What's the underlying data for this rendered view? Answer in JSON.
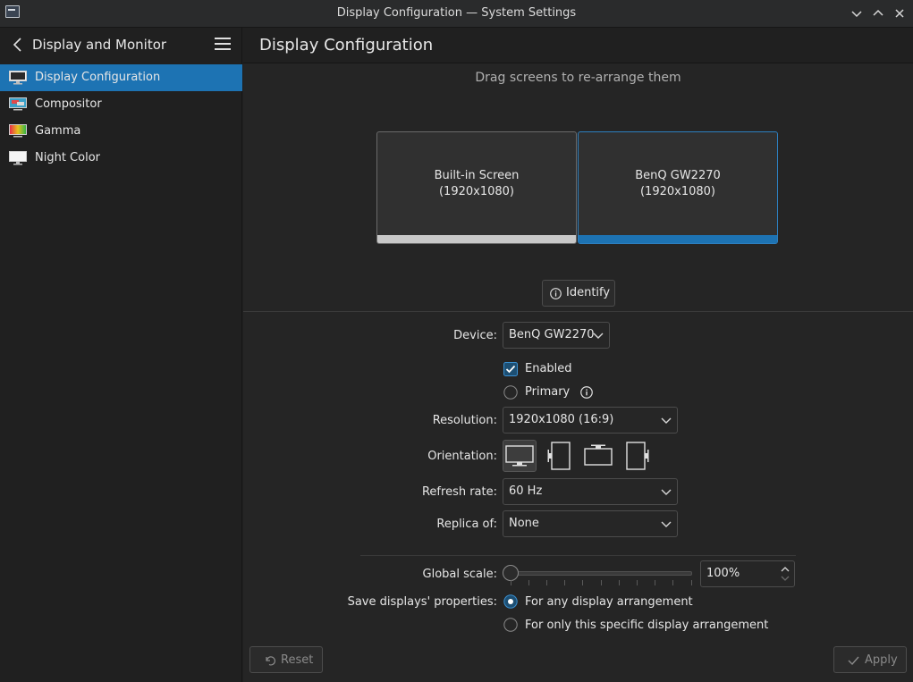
{
  "window": {
    "title": "Display Configuration — System Settings"
  },
  "sidebar": {
    "header_title": "Display and Monitor",
    "items": [
      {
        "label": "Display Configuration",
        "icon": "monitor-icon",
        "active": true
      },
      {
        "label": "Compositor",
        "icon": "compositor-icon"
      },
      {
        "label": "Gamma",
        "icon": "gamma-icon"
      },
      {
        "label": "Night Color",
        "icon": "night-color-icon"
      }
    ]
  },
  "main": {
    "title": "Display Configuration",
    "hint": "Drag screens to re-arrange them",
    "screens": [
      {
        "name": "Built-in Screen",
        "resolution": "(1920x1080)",
        "selected": false
      },
      {
        "name": "BenQ GW2270",
        "resolution": "(1920x1080)",
        "selected": true
      }
    ],
    "identify_label": "Identify",
    "form": {
      "device_label": "Device:",
      "device_value": "BenQ GW2270",
      "enabled_label": "Enabled",
      "enabled_checked": true,
      "primary_label": "Primary",
      "primary_checked": false,
      "resolution_label": "Resolution:",
      "resolution_value": "1920x1080 (16:9)",
      "orientation_label": "Orientation:",
      "refresh_label": "Refresh rate:",
      "refresh_value": "60 Hz",
      "replica_label": "Replica of:",
      "replica_value": "None",
      "scale_label": "Global scale:",
      "scale_value": "100%",
      "save_label": "Save displays' properties:",
      "save_option_any": "For any display arrangement",
      "save_option_specific": "For only this specific display arrangement",
      "save_selected": "any"
    },
    "reset_label": "Reset",
    "apply_label": "Apply"
  },
  "colors": {
    "accent": "#1d73b3",
    "background": "#252525",
    "sidebar": "#202020"
  }
}
